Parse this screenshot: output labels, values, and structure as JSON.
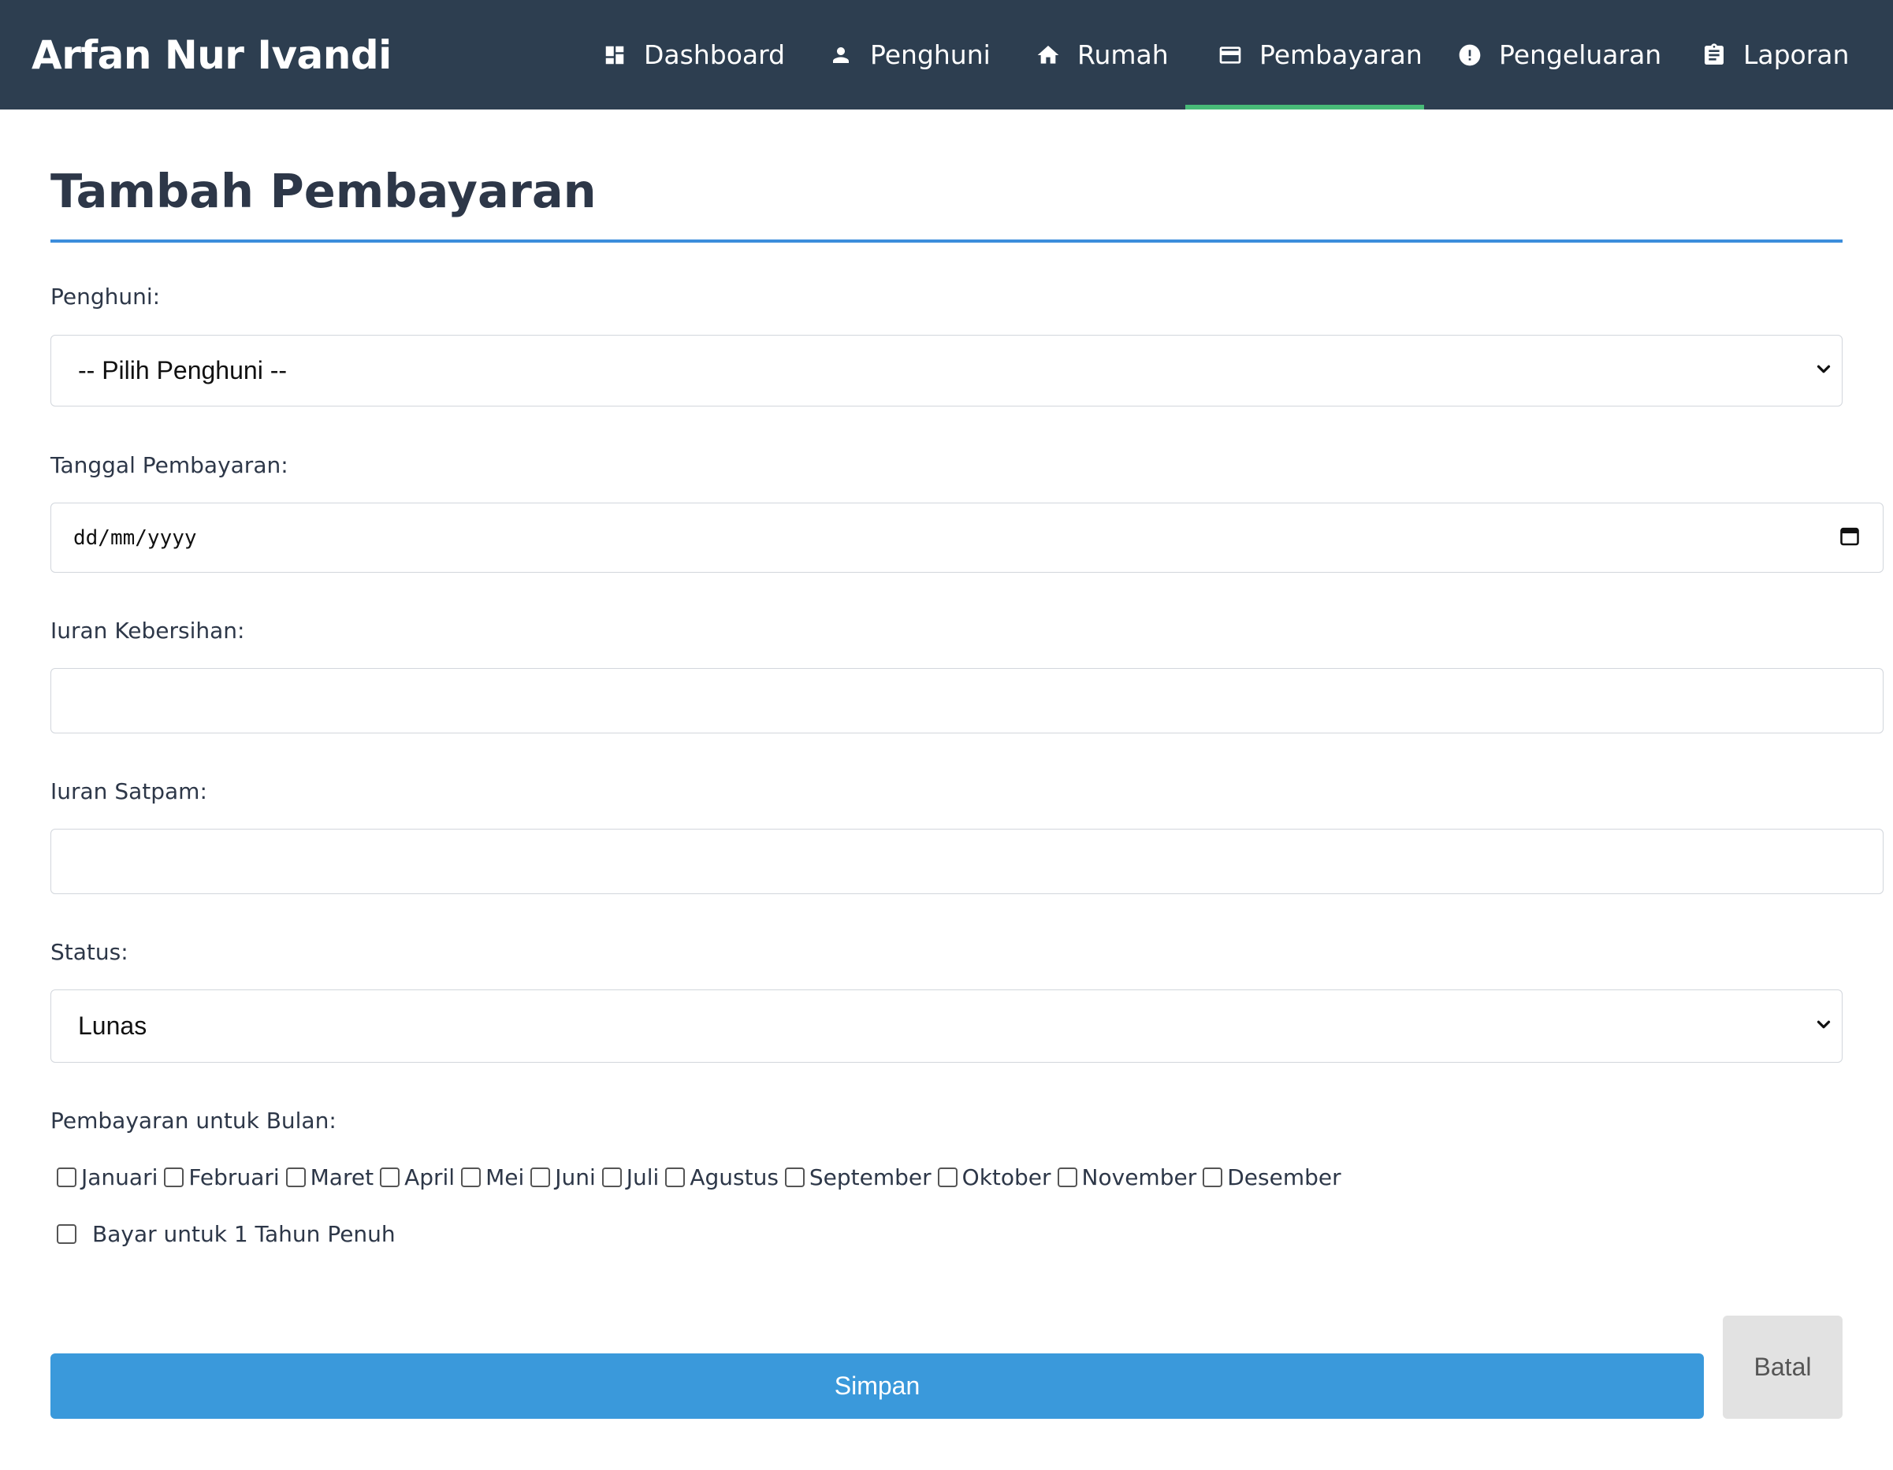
{
  "brand": "Arfan Nur Ivandi",
  "nav": {
    "dashboard": "Dashboard",
    "penghuni": "Penghuni",
    "rumah": "Rumah",
    "pembayaran": "Pembayaran",
    "pengeluaran": "Pengeluaran",
    "laporan": "Laporan",
    "active": "Pembayaran"
  },
  "page_title": "Tambah Pembayaran",
  "form": {
    "penghuni": {
      "label": "Penghuni:",
      "selected": "-- Pilih Penghuni --"
    },
    "tanggal": {
      "label": "Tanggal Pembayaran:",
      "placeholder": "dd/mm/yyyy"
    },
    "kebersihan": {
      "label": "Iuran Kebersihan:",
      "value": ""
    },
    "satpam": {
      "label": "Iuran Satpam:",
      "value": ""
    },
    "status": {
      "label": "Status:",
      "selected": "Lunas"
    },
    "bulan": {
      "label": "Pembayaran untuk Bulan:",
      "months": [
        "Januari",
        "Februari",
        "Maret",
        "April",
        "Mei",
        "Juni",
        "Juli",
        "Agustus",
        "September",
        "Oktober",
        "November",
        "Desember"
      ],
      "checked": [
        false,
        false,
        false,
        false,
        false,
        false,
        false,
        false,
        false,
        false,
        false,
        false
      ]
    },
    "full_year": {
      "label": "Bayar untuk 1 Tahun Penuh",
      "checked": false
    }
  },
  "buttons": {
    "save": "Simpan",
    "cancel": "Batal"
  },
  "colors": {
    "navbar": "#2d3e50",
    "active_underline": "#48bb78",
    "title_rule": "#3c8ddc",
    "save_button": "#3a99db",
    "cancel_button": "#e2e2e2"
  }
}
